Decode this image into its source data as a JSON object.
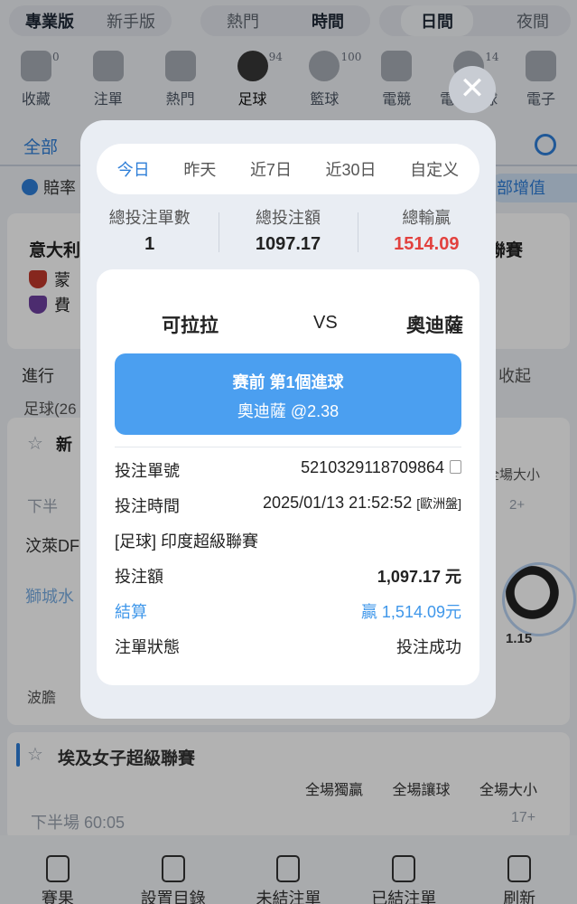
{
  "background": {
    "top_segments": [
      "專業版",
      "新手版"
    ],
    "sort_segments": [
      "熱門",
      "時間"
    ],
    "day_segments": [
      "日間",
      "夜間"
    ],
    "sports": [
      {
        "label": "收藏",
        "count": "0"
      },
      {
        "label": "注單",
        "count": ""
      },
      {
        "label": "熱門",
        "count": ""
      },
      {
        "label": "足球",
        "count": "94"
      },
      {
        "label": "籃球",
        "count": "100"
      },
      {
        "label": "電競",
        "count": ""
      },
      {
        "label": "電子足球",
        "count": "14"
      },
      {
        "label": "電子",
        "count": ""
      }
    ],
    "nav_all": "全部",
    "odds_label": "賠率",
    "value_button": "部增值",
    "league1": "意大利",
    "league1_right": "聯賽",
    "team_a": "蒙",
    "team_b": "費",
    "in_progress": "進行",
    "collapse": "收起",
    "football_count": "足球(26",
    "league2": "新",
    "half_time": "下半",
    "team_c": "汶萊DF",
    "team_d": "獅城水",
    "side_header": "全場大小",
    "side_two": "2+",
    "odds_115": "1.15",
    "bodan": "波膽",
    "league3": "埃及女子超級聯賽",
    "cols": [
      "全場獨贏",
      "全場讓球",
      "全場大小"
    ],
    "half_time_3": "下半場 60:05",
    "count_17": "17+",
    "tabbar": [
      "賽果",
      "設置目錄",
      "未結注單",
      "已結注單",
      "刷新"
    ]
  },
  "modal": {
    "close_icon": "close-icon",
    "tabs": [
      "今日",
      "昨天",
      "近7日",
      "近30日",
      "自定义"
    ],
    "active_tab": 0,
    "stats": {
      "total_bets_label": "總投注單數",
      "total_bets": "1",
      "total_amount_label": "總投注額",
      "total_amount": "1097.17",
      "total_win_label": "總輸贏",
      "total_win": "1514.09"
    },
    "match": {
      "home": "可拉拉",
      "vs": "VS",
      "away": "奧迪薩"
    },
    "pick": {
      "line1": "赛前  第1個進球",
      "line2": "奧迪薩 @2.38"
    },
    "details": {
      "order_no_label": "投注單號",
      "order_no": "5210329118709864",
      "time_label": "投注時間",
      "time": "2025/01/13 21:52:52",
      "market": "[歐洲盤]",
      "league": "[足球] 印度超級聯賽",
      "amount_label": "投注額",
      "amount": "1,097.17 元",
      "settle_label": "結算",
      "settle": "贏 1,514.09元",
      "status_label": "注單狀態",
      "status": "投注成功"
    },
    "colors": {
      "accent": "#2f7fd8",
      "pick_bg": "#4b9ff0",
      "loss_red": "#e2413e"
    }
  }
}
